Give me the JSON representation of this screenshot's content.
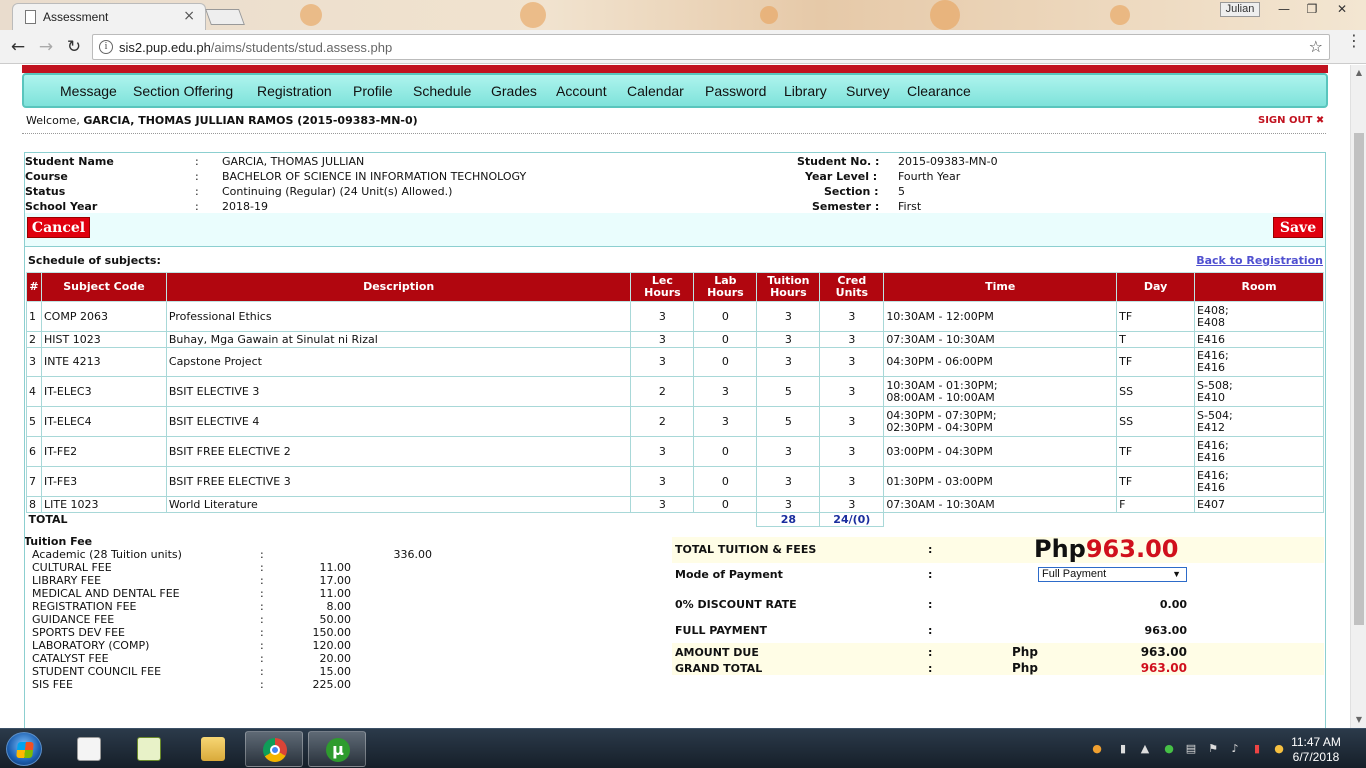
{
  "browser": {
    "tab_title": "Assessment",
    "tab_close": "×",
    "user_badge": "Julian",
    "url_host": "sis2.pup.edu.ph",
    "url_path": "/aims/students/stud.assess.php",
    "win_min": "—",
    "win_max": "❐",
    "win_close": "✕"
  },
  "menu": {
    "items": [
      "Message",
      "Section Offering",
      "Registration",
      "Profile",
      "Schedule",
      "Grades",
      "Account",
      "Calendar",
      "Password",
      "Library",
      "Survey",
      "Clearance"
    ]
  },
  "welcome": {
    "prefix": "Welcome, ",
    "name": "GARCIA, THOMAS JULLIAN RAMOS (2015-09383-MN-0)",
    "signout": "SIGN OUT"
  },
  "student": {
    "name_label": "Student Name",
    "name": "GARCIA, THOMAS JULLIAN",
    "course_label": "Course",
    "course": "BACHELOR OF SCIENCE IN INFORMATION TECHNOLOGY",
    "status_label": "Status",
    "status": "Continuing (Regular) (24 Unit(s) Allowed.)",
    "sy_label": "School Year",
    "sy": "2018-19",
    "no_label": "Student No. :",
    "no": "2015-09383-MN-0",
    "year_label": "Year Level :",
    "year": "Fourth Year",
    "section_label": "Section :",
    "section": "5",
    "semester_label": "Semester :",
    "semester": "First",
    "colon": ":"
  },
  "actions": {
    "cancel": "Cancel",
    "save": "Save"
  },
  "schedule": {
    "title": "Schedule of subjects:",
    "back_link": "Back to Registration",
    "headers": {
      "num": "#",
      "code": "Subject Code",
      "desc": "Description",
      "lec1": "Lec",
      "lec2": "Hours",
      "lab1": "Lab",
      "lab2": "Hours",
      "tui1": "Tuition",
      "tui2": "Hours",
      "cred1": "Cred",
      "cred2": "Units",
      "time": "Time",
      "day": "Day",
      "room": "Room"
    },
    "rows": [
      {
        "n": "1",
        "code": "COMP 2063",
        "desc": "Professional Ethics",
        "lec": "3",
        "lab": "0",
        "tui": "3",
        "cred": "3",
        "time1": "10:30AM - 12:00PM",
        "time2": "",
        "day": "TF",
        "room1": "E408;",
        "room2": "E408"
      },
      {
        "n": "2",
        "code": "HIST 1023",
        "desc": "Buhay, Mga Gawain at Sinulat ni Rizal",
        "lec": "3",
        "lab": "0",
        "tui": "3",
        "cred": "3",
        "time1": "07:30AM - 10:30AM",
        "time2": "",
        "day": "T",
        "room1": "E416",
        "room2": ""
      },
      {
        "n": "3",
        "code": "INTE 4213",
        "desc": "Capstone Project",
        "lec": "3",
        "lab": "0",
        "tui": "3",
        "cred": "3",
        "time1": "04:30PM - 06:00PM",
        "time2": "",
        "day": "TF",
        "room1": "E416;",
        "room2": "E416"
      },
      {
        "n": "4",
        "code": "IT-ELEC3",
        "desc": "BSIT ELECTIVE 3",
        "lec": "2",
        "lab": "3",
        "tui": "5",
        "cred": "3",
        "time1": "10:30AM - 01:30PM;",
        "time2": "08:00AM - 10:00AM",
        "day": "SS",
        "room1": "S-508;",
        "room2": "E410"
      },
      {
        "n": "5",
        "code": "IT-ELEC4",
        "desc": "BSIT ELECTIVE 4",
        "lec": "2",
        "lab": "3",
        "tui": "5",
        "cred": "3",
        "time1": "04:30PM - 07:30PM;",
        "time2": "02:30PM - 04:30PM",
        "day": "SS",
        "room1": "S-504;",
        "room2": "E412"
      },
      {
        "n": "6",
        "code": "IT-FE2",
        "desc": "BSIT FREE ELECTIVE 2",
        "lec": "3",
        "lab": "0",
        "tui": "3",
        "cred": "3",
        "time1": "03:00PM - 04:30PM",
        "time2": "",
        "day": "TF",
        "room1": "E416;",
        "room2": "E416"
      },
      {
        "n": "7",
        "code": "IT-FE3",
        "desc": "BSIT FREE ELECTIVE 3",
        "lec": "3",
        "lab": "0",
        "tui": "3",
        "cred": "3",
        "time1": "01:30PM - 03:00PM",
        "time2": "",
        "day": "TF",
        "room1": "E416;",
        "room2": "E416"
      },
      {
        "n": "8",
        "code": "LITE 1023",
        "desc": "World Literature",
        "lec": "3",
        "lab": "0",
        "tui": "3",
        "cred": "3",
        "time1": "07:30AM - 10:30AM",
        "time2": "",
        "day": "F",
        "room1": "E407",
        "room2": ""
      }
    ],
    "total_label": "TOTAL",
    "total_tuition": "28",
    "total_cred": "24/(0)"
  },
  "fees": {
    "title": "Tuition Fee",
    "academic_label": "Academic (28 Tuition units)",
    "academic_amount": "336.00",
    "items": [
      {
        "label": "CULTURAL FEE",
        "amount": "11.00"
      },
      {
        "label": "LIBRARY FEE",
        "amount": "17.00"
      },
      {
        "label": "MEDICAL AND DENTAL FEE",
        "amount": "11.00"
      },
      {
        "label": "REGISTRATION FEE",
        "amount": "8.00"
      },
      {
        "label": "GUIDANCE FEE",
        "amount": "50.00"
      },
      {
        "label": "SPORTS DEV FEE",
        "amount": "150.00"
      },
      {
        "label": "LABORATORY (COMP)",
        "amount": "120.00"
      },
      {
        "label": "CATALYST FEE",
        "amount": "20.00"
      },
      {
        "label": "STUDENT COUNCIL FEE",
        "amount": "15.00"
      },
      {
        "label": "SIS FEE",
        "amount": "225.00"
      }
    ],
    "colon": ":"
  },
  "summary": {
    "total_label": "TOTAL TUITION & FEES",
    "total_prefix": "Php",
    "total_value": "963.00",
    "mode_label": "Mode of Payment",
    "mode_value": "Full Payment",
    "discount_label": "0% DISCOUNT RATE",
    "discount_value": "0.00",
    "full_label": "FULL PAYMENT",
    "full_value": "963.00",
    "due_label": "AMOUNT DUE",
    "due_php": "Php",
    "due_value": "963.00",
    "grand_label": "GRAND TOTAL",
    "grand_php": "Php",
    "grand_value": "963.00",
    "colon": ":"
  },
  "taskbar": {
    "time": "11:47 AM",
    "date": "6/7/2018"
  },
  "colors": {
    "header_red": "#b1060f",
    "button_red": "#e0000e",
    "menu_teal": "#7ee2da",
    "total_red": "#d0101d",
    "link_blue": "#5050d0"
  }
}
